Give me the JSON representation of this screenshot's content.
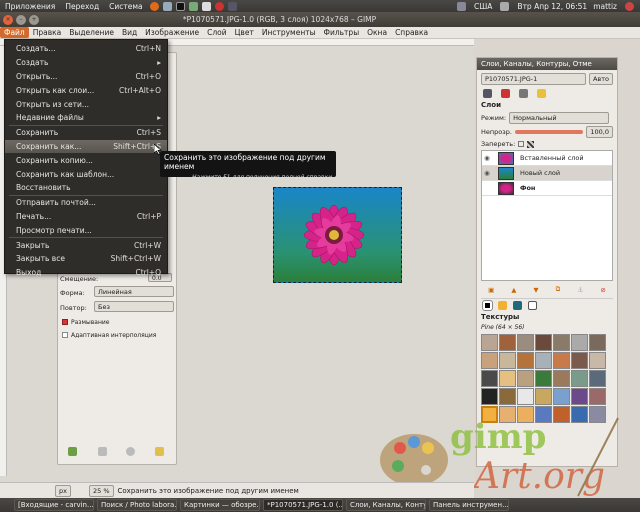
{
  "top_panel": {
    "menus": [
      "Приложения",
      "Переход",
      "Система"
    ],
    "keyboard": "США",
    "clock": "Втр Апр 12, 06:51",
    "user": "mattiz"
  },
  "window": {
    "title": "*P1070571.JPG-1.0 (RGB, 3 слоя) 1024x768 – GIMP"
  },
  "menubar": [
    "Файл",
    "Правка",
    "Выделение",
    "Вид",
    "Изображение",
    "Слой",
    "Цвет",
    "Инструменты",
    "Фильтры",
    "Окна",
    "Справка"
  ],
  "file_menu": {
    "groups": [
      [
        {
          "label": "Создать...",
          "shortcut": "Ctrl+N"
        },
        {
          "label": "Создать",
          "shortcut": "▸"
        },
        {
          "label": "Открыть...",
          "shortcut": "Ctrl+O"
        },
        {
          "label": "Открыть как слои...",
          "shortcut": "Ctrl+Alt+O"
        },
        {
          "label": "Открыть из сети...",
          "shortcut": ""
        },
        {
          "label": "Недавние файлы",
          "shortcut": "▸"
        }
      ],
      [
        {
          "label": "Сохранить",
          "shortcut": "Ctrl+S"
        },
        {
          "label": "Сохранить как...",
          "shortcut": "Shift+Ctrl+S"
        },
        {
          "label": "Сохранить копию...",
          "shortcut": ""
        },
        {
          "label": "Сохранить как шаблон...",
          "shortcut": ""
        },
        {
          "label": "Восстановить",
          "shortcut": ""
        }
      ],
      [
        {
          "label": "Отправить почтой...",
          "shortcut": ""
        },
        {
          "label": "Печать...",
          "shortcut": "Ctrl+P"
        },
        {
          "label": "Просмотр печати...",
          "shortcut": ""
        }
      ],
      [
        {
          "label": "Закрыть",
          "shortcut": "Ctrl+W"
        },
        {
          "label": "Закрыть все",
          "shortcut": "Shift+Ctrl+W"
        },
        {
          "label": "Выход",
          "shortcut": "Ctrl+Q"
        }
      ]
    ],
    "highlighted": "Сохранить как..."
  },
  "tooltip": {
    "text": "Сохранить это изображение под другим именем",
    "hint": "Нажмите F1 для получения полной справки"
  },
  "toolbox": {
    "offset_label": "Смещение:",
    "offset_value": "0.0",
    "shape_label": "Форма:",
    "shape_value": "Линейная",
    "repeat_label": "Повтор:",
    "repeat_value": "Без",
    "dither_label": "Размывание",
    "adaptive_label": "Адаптивная интерполяция"
  },
  "dock": {
    "title": "Слои, Каналы, Контуры, Отме",
    "image_select": "P1070571.JPG-1",
    "auto_button": "Авто",
    "layers_title": "Слои",
    "mode_label": "Режим:",
    "mode_value": "Нормальный",
    "opacity_label": "Непрозр.",
    "opacity_value": "100,0",
    "lock_label": "Запереть:",
    "layers": [
      "Вставленный слой",
      "Новый слой",
      "Фон"
    ],
    "textures_title": "Текстуры",
    "texture_name": "Pine (64 × 56)"
  },
  "status": {
    "unit": "px",
    "zoom": "25 %",
    "message": "Сохранить это изображение под другим именем"
  },
  "taskbar": [
    "[Входящие - carvin...",
    "Поиск / Photo labora...",
    "Картинки — обозре...",
    "*P1070571.JPG-1.0 (...",
    "Слои, Каналы, Конту...",
    "Панель инструмен..."
  ],
  "watermark": {
    "line1": "gimp",
    "line2": "Art.org"
  },
  "colors": {
    "accent": "#d26a2d",
    "menu_bg": "#2f2d2a",
    "panel": "#3a3834"
  }
}
